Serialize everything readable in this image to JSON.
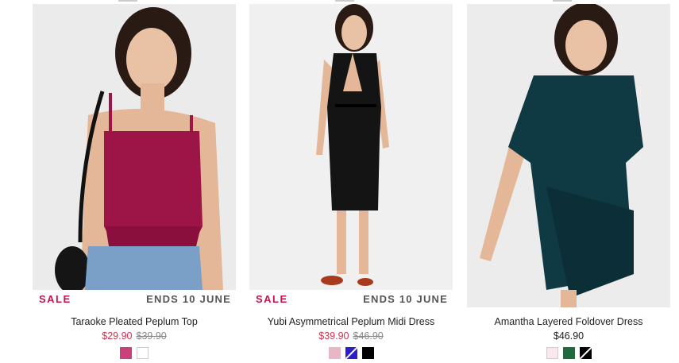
{
  "products": [
    {
      "name": "Taraoke Pleated Peplum Top",
      "sale_label": "SALE",
      "promo_label": "ENDS 10 JUNE",
      "price": "$29.90",
      "original_price": "$39.90",
      "swatch_colors": [
        "#c8417a",
        "#ffffff"
      ]
    },
    {
      "name": "Yubi Asymmetrical Peplum Midi Dress",
      "sale_label": "SALE",
      "promo_label": "ENDS 10 JUNE",
      "price": "$39.90",
      "original_price": "$46.90",
      "swatch_colors": [
        "#e8b6c4",
        "#2b1fc8",
        "#000000"
      ]
    },
    {
      "name": "Amantha Layered Foldover Dress",
      "price": "$46.90",
      "swatch_colors": [
        "#fbe8ee",
        "#1c6b3c",
        "#000000"
      ]
    }
  ]
}
